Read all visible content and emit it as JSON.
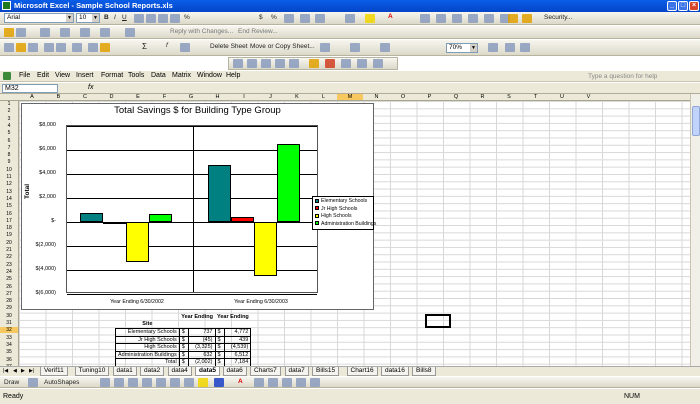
{
  "window": {
    "title": "Microsoft Excel - Sample School Reports.xls"
  },
  "toolbar": {
    "font": "Arial",
    "size": "10",
    "security": "Security...",
    "reply_changes": "Reply with Changes...",
    "end_review": "End Review...",
    "delete_sheet": "Delete Sheet",
    "move_copy": "Move or Copy Sheet...",
    "zoom": "70%"
  },
  "menu": {
    "items": [
      "File",
      "Edit",
      "View",
      "Insert",
      "Format",
      "Tools",
      "Data",
      "Matrix",
      "Window",
      "Help"
    ]
  },
  "ask_placeholder": "Type a question for help",
  "formula_bar": {
    "name_box": "M32",
    "fx": "fx"
  },
  "columns": [
    "A",
    "B",
    "C",
    "D",
    "E",
    "F",
    "G",
    "H",
    "I",
    "J",
    "K",
    "L",
    "M",
    "N",
    "O",
    "P",
    "Q",
    "R",
    "S",
    "T",
    "U",
    "V"
  ],
  "selected_column": "M",
  "selected_row": "32",
  "chart_data": {
    "type": "bar",
    "title": "Total Savings $ for Building Type Group",
    "ylabel": "Total",
    "xlabel": "",
    "ylim": [
      -6000,
      8000
    ],
    "y_ticks": [
      "$8,000",
      "$6,000",
      "$4,000",
      "$2,000",
      "$-",
      "$(2,000)",
      "$(4,000)",
      "$(6,000)"
    ],
    "categories": [
      "Year Ending 6/30/2002",
      "Year Ending 6/30/2003"
    ],
    "series": [
      {
        "name": "Elementary Schools",
        "color": "#008080",
        "values": [
          737,
          4772
        ]
      },
      {
        "name": "Jr High Schools",
        "color": "#ff0000",
        "values": [
          -45,
          439
        ]
      },
      {
        "name": "High Schools",
        "color": "#ffff00",
        "values": [
          -3325,
          -4539
        ]
      },
      {
        "name": "Administration Buildings",
        "color": "#00ff00",
        "values": [
          632,
          6512
        ]
      }
    ],
    "legend": "right",
    "grid": true
  },
  "summary_table": {
    "headers": [
      "Site",
      "Year Ending",
      "Year Ending"
    ],
    "rows": [
      [
        "Elementary Schools",
        "$",
        "737",
        "$",
        "4,772"
      ],
      [
        "Jr High Schools",
        "$",
        "(45)",
        "$",
        "439"
      ],
      [
        "High Schools",
        "$",
        "(3,325)",
        "$",
        "(4,539)"
      ],
      [
        "Administration Buildings",
        "$",
        "632",
        "$",
        "6,512"
      ],
      [
        "Total",
        "$",
        "(2,002)",
        "$",
        "7,184"
      ]
    ]
  },
  "sheet_tabs": [
    "Verif11",
    "Tuning10",
    "data1",
    "data2",
    "data4",
    "data5",
    "data6",
    "Charts7",
    "data7",
    "Bills15",
    "Chart16",
    "data16",
    "Bills8"
  ],
  "active_tab": "data5",
  "draw_toolbar": {
    "draw": "Draw",
    "autoshapes": "AutoShapes"
  },
  "status": {
    "left": "Ready",
    "right": "NUM"
  }
}
